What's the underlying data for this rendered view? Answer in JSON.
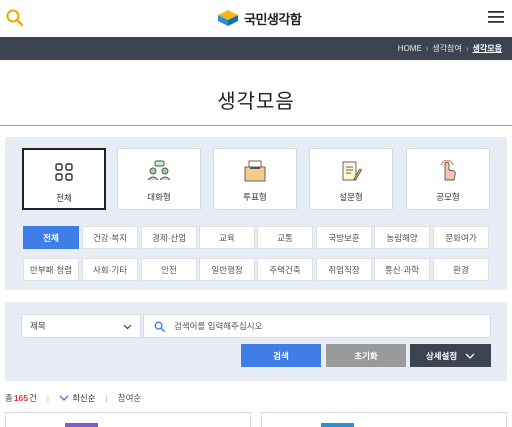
{
  "header": {
    "logo_text": "국민생각함",
    "search_icon": "search-icon",
    "menu_icon": "hamburger-menu-icon",
    "accent_color": "#f0a500"
  },
  "breadcrumb": {
    "items": [
      "HOME",
      "생각참여",
      "생각모음"
    ]
  },
  "page": {
    "title": "생각모음"
  },
  "types": [
    {
      "label": "전체",
      "icon": "grid-icon",
      "active": true
    },
    {
      "label": "대화형",
      "icon": "people-chat-icon",
      "active": false
    },
    {
      "label": "투표형",
      "icon": "ballot-box-icon",
      "active": false
    },
    {
      "label": "설문형",
      "icon": "survey-clipboard-icon",
      "active": false
    },
    {
      "label": "공모형",
      "icon": "hand-pointer-icon",
      "active": false
    }
  ],
  "categories": [
    "전체",
    "건강·복지",
    "경제·산업",
    "교육",
    "교통",
    "국방보훈",
    "농림해양",
    "문화여가",
    "반부패·청렴",
    "사회·기타",
    "안전",
    "일반행정",
    "주택건축",
    "취업직장",
    "통신·과학",
    "환경"
  ],
  "search": {
    "field_select": "제목",
    "placeholder": "검색어를 입력해주십시오",
    "search_button": "검색",
    "reset_button": "초기화",
    "detail_button": "상세설정"
  },
  "results": {
    "total_prefix": "총",
    "total_count": "165",
    "total_suffix": "건",
    "sort_latest": "최신순",
    "sort_popular": "참여순"
  },
  "colors": {
    "primary": "#3f7ee6",
    "dark": "#3d4350",
    "count_red": "#e03a3a",
    "panel_bg": "#e8edf5"
  }
}
